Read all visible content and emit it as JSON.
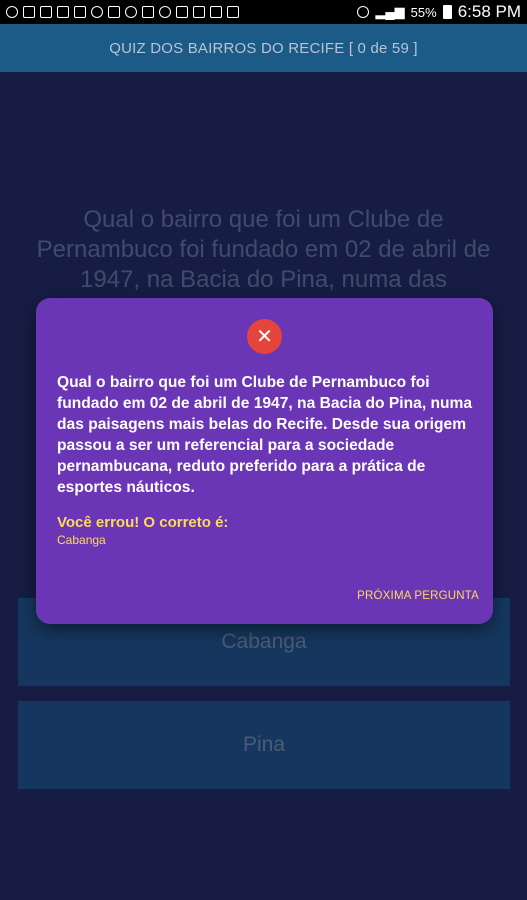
{
  "status_bar": {
    "battery": "55%",
    "time": "6:58 PM"
  },
  "app_bar": {
    "title": "QUIZ DOS BAIRROS DO RECIFE [ 0 de 59 ]"
  },
  "question": {
    "text": "Qual o bairro que foi um Clube de Pernambuco foi fundado em 02 de abril de 1947, na Bacia do Pina, numa das"
  },
  "answers": [
    {
      "label": "Cabanga"
    },
    {
      "label": "Pina"
    }
  ],
  "dialog": {
    "close_symbol": "✕",
    "question": "Qual o bairro que foi um Clube de Pernambuco foi fundado em 02 de abril de 1947, na Bacia do Pina, numa das paisagens mais belas do Recife. Desde sua origem passou a ser um referencial para a sociedade pernambucana, reduto preferido para a prática de esportes náuticos.",
    "wrong_label": "Você errou! O correto é:",
    "correct_answer": "Cabanga",
    "next_button": "PRÓXIMA PERGUNTA"
  },
  "colors": {
    "background": "#1f2557",
    "app_bar": "#1c5a87",
    "dialog": "#6a36b6",
    "close_button": "#e5443a",
    "highlight_text": "#ffd95a"
  }
}
